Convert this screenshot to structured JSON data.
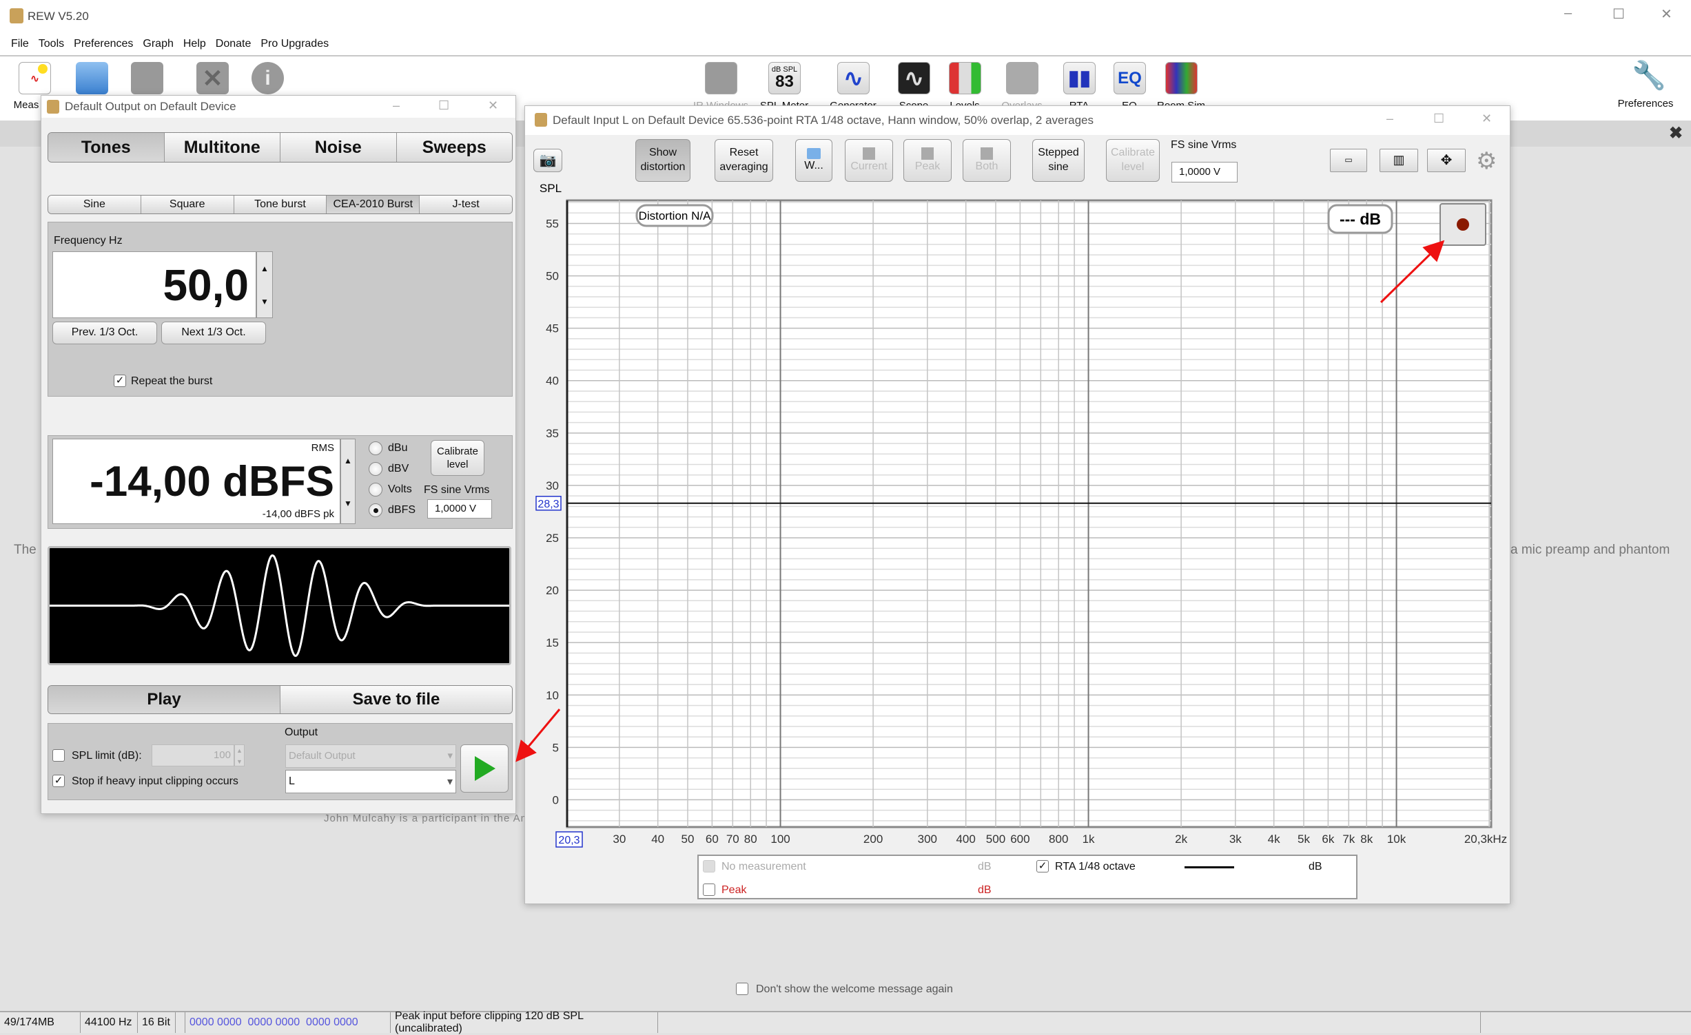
{
  "app": {
    "title": "REW V5.20"
  },
  "menu": [
    "File",
    "Tools",
    "Preferences",
    "Graph",
    "Help",
    "Donate",
    "Pro Upgrades"
  ],
  "toolbar": {
    "left": [
      {
        "icon": "measure-icon",
        "label": "Meas"
      },
      {
        "icon": "open-folder-icon"
      },
      {
        "icon": "save-icon"
      },
      {
        "icon": "remove-icon"
      },
      {
        "icon": "info-icon"
      }
    ],
    "center": [
      {
        "icon": "ir-windows-icon",
        "label": "IR Windows",
        "text": ""
      },
      {
        "icon": "spl-meter-icon",
        "label": "SPL Meter",
        "text": "83",
        "sub": "dB SPL"
      },
      {
        "icon": "generator-icon",
        "label": "Generator",
        "text": ""
      },
      {
        "icon": "scope-icon",
        "label": "Scope",
        "text": ""
      },
      {
        "icon": "levels-icon",
        "label": "Levels",
        "text": ""
      },
      {
        "icon": "overlays-icon",
        "label": "Overlays",
        "text": ""
      },
      {
        "icon": "rta-icon",
        "label": "RTA",
        "text": ""
      },
      {
        "icon": "eq-icon",
        "label": "EQ",
        "text": "EQ"
      },
      {
        "icon": "room-sim-icon",
        "label": "Room Sim",
        "text": ""
      }
    ],
    "preferences": "Preferences"
  },
  "background": {
    "left_text": "The",
    "right_text": "a mic preamp and phantom",
    "credit": "John Mulcahy is a participant in the Ama",
    "dont_show": "Don't show the welcome message again"
  },
  "generator": {
    "title": "Default Output on Default Device",
    "tabs": [
      "Tones",
      "Multitone",
      "Noise",
      "Sweeps"
    ],
    "subtabs": [
      "Sine",
      "Square",
      "Tone burst",
      "CEA-2010 Burst",
      "J-test"
    ],
    "frequency_label": "Frequency Hz",
    "frequency": "50,0",
    "prev": "Prev. 1/3 Oct.",
    "next": "Next 1/3 Oct.",
    "repeat": "Repeat the burst",
    "repeat_checked": true,
    "rms": "RMS",
    "level": "-14,00 dBFS",
    "level_pk": "-14,00 dBFS pk",
    "units": [
      "dBu",
      "dBV",
      "Volts",
      "dBFS"
    ],
    "unit_selected": "dBFS",
    "calibrate": "Calibrate level",
    "fs_label": "FS sine Vrms",
    "fs_value": "1,0000 V",
    "play": "Play",
    "save": "Save to file",
    "spl_limit": "SPL limit (dB):",
    "spl_limit_value": "100",
    "spl_limit_checked": false,
    "stop_clip": "Stop if heavy input clipping occurs",
    "stop_clip_checked": true,
    "output_label": "Output",
    "output_device": "Default Output",
    "output_channel": "L"
  },
  "rta": {
    "title": "Default Input L on Default Device 65.536-point RTA 1/48 octave, Hann window, 50% overlap, 2 averages",
    "buttons": {
      "show_distortion": "Show distortion",
      "reset_averaging": "Reset averaging",
      "w": "W...",
      "current": "Current",
      "peak": "Peak",
      "both": "Both",
      "stepped_sine": "Stepped sine",
      "calibrate": "Calibrate level"
    },
    "fs_label": "FS sine Vrms",
    "fs_value": "1,0000 V",
    "distortion": "Distortion N/A",
    "db_readout": "--- dB",
    "cursor_y": "28,3",
    "cursor_x": "20,3",
    "legend": [
      {
        "label": "No measurement",
        "unit": "dB",
        "checked": false,
        "color": "#aaaaaa"
      },
      {
        "label": "RTA 1/48 octave",
        "unit": "dB",
        "checked": true,
        "color": "#000000"
      },
      {
        "label": "Peak",
        "unit": "dB",
        "checked": false,
        "color": "#cc2222"
      }
    ]
  },
  "chart_data": {
    "type": "line",
    "ylabel": "SPL",
    "xscale": "log",
    "xlim": [
      20.3,
      20300
    ],
    "ylim": [
      -2.6,
      57.2
    ],
    "y_ticks": [
      0,
      5,
      10,
      15,
      20,
      25,
      30,
      35,
      40,
      45,
      50,
      55
    ],
    "x_ticks": [
      30,
      40,
      50,
      60,
      70,
      80,
      100,
      200,
      300,
      400,
      500,
      600,
      800,
      1000,
      2000,
      3000,
      4000,
      5000,
      6000,
      7000,
      8000,
      10000,
      20300
    ],
    "x_tick_labels": [
      "30",
      "40",
      "50",
      "60",
      "70",
      "80",
      "100",
      "200",
      "300",
      "400",
      "500",
      "600",
      "800",
      "1k",
      "2k",
      "3k",
      "4k",
      "5k",
      "6k",
      "7k",
      "8k",
      "10k",
      "20,3kHz"
    ],
    "grid": true,
    "cursor_level": 28.3,
    "series": []
  },
  "status": {
    "memory": "49/174MB",
    "rate": "44100 Hz",
    "bits": "16 Bit",
    "bits_display": "0000 0000  0000 0000  0000 0000",
    "peak": "Peak input before clipping 120 dB SPL (uncalibrated)"
  },
  "colors": {
    "play_arrow": "#22aa22",
    "annotation_arrow": "#ee1111",
    "cursor_label": "#2233cc"
  }
}
